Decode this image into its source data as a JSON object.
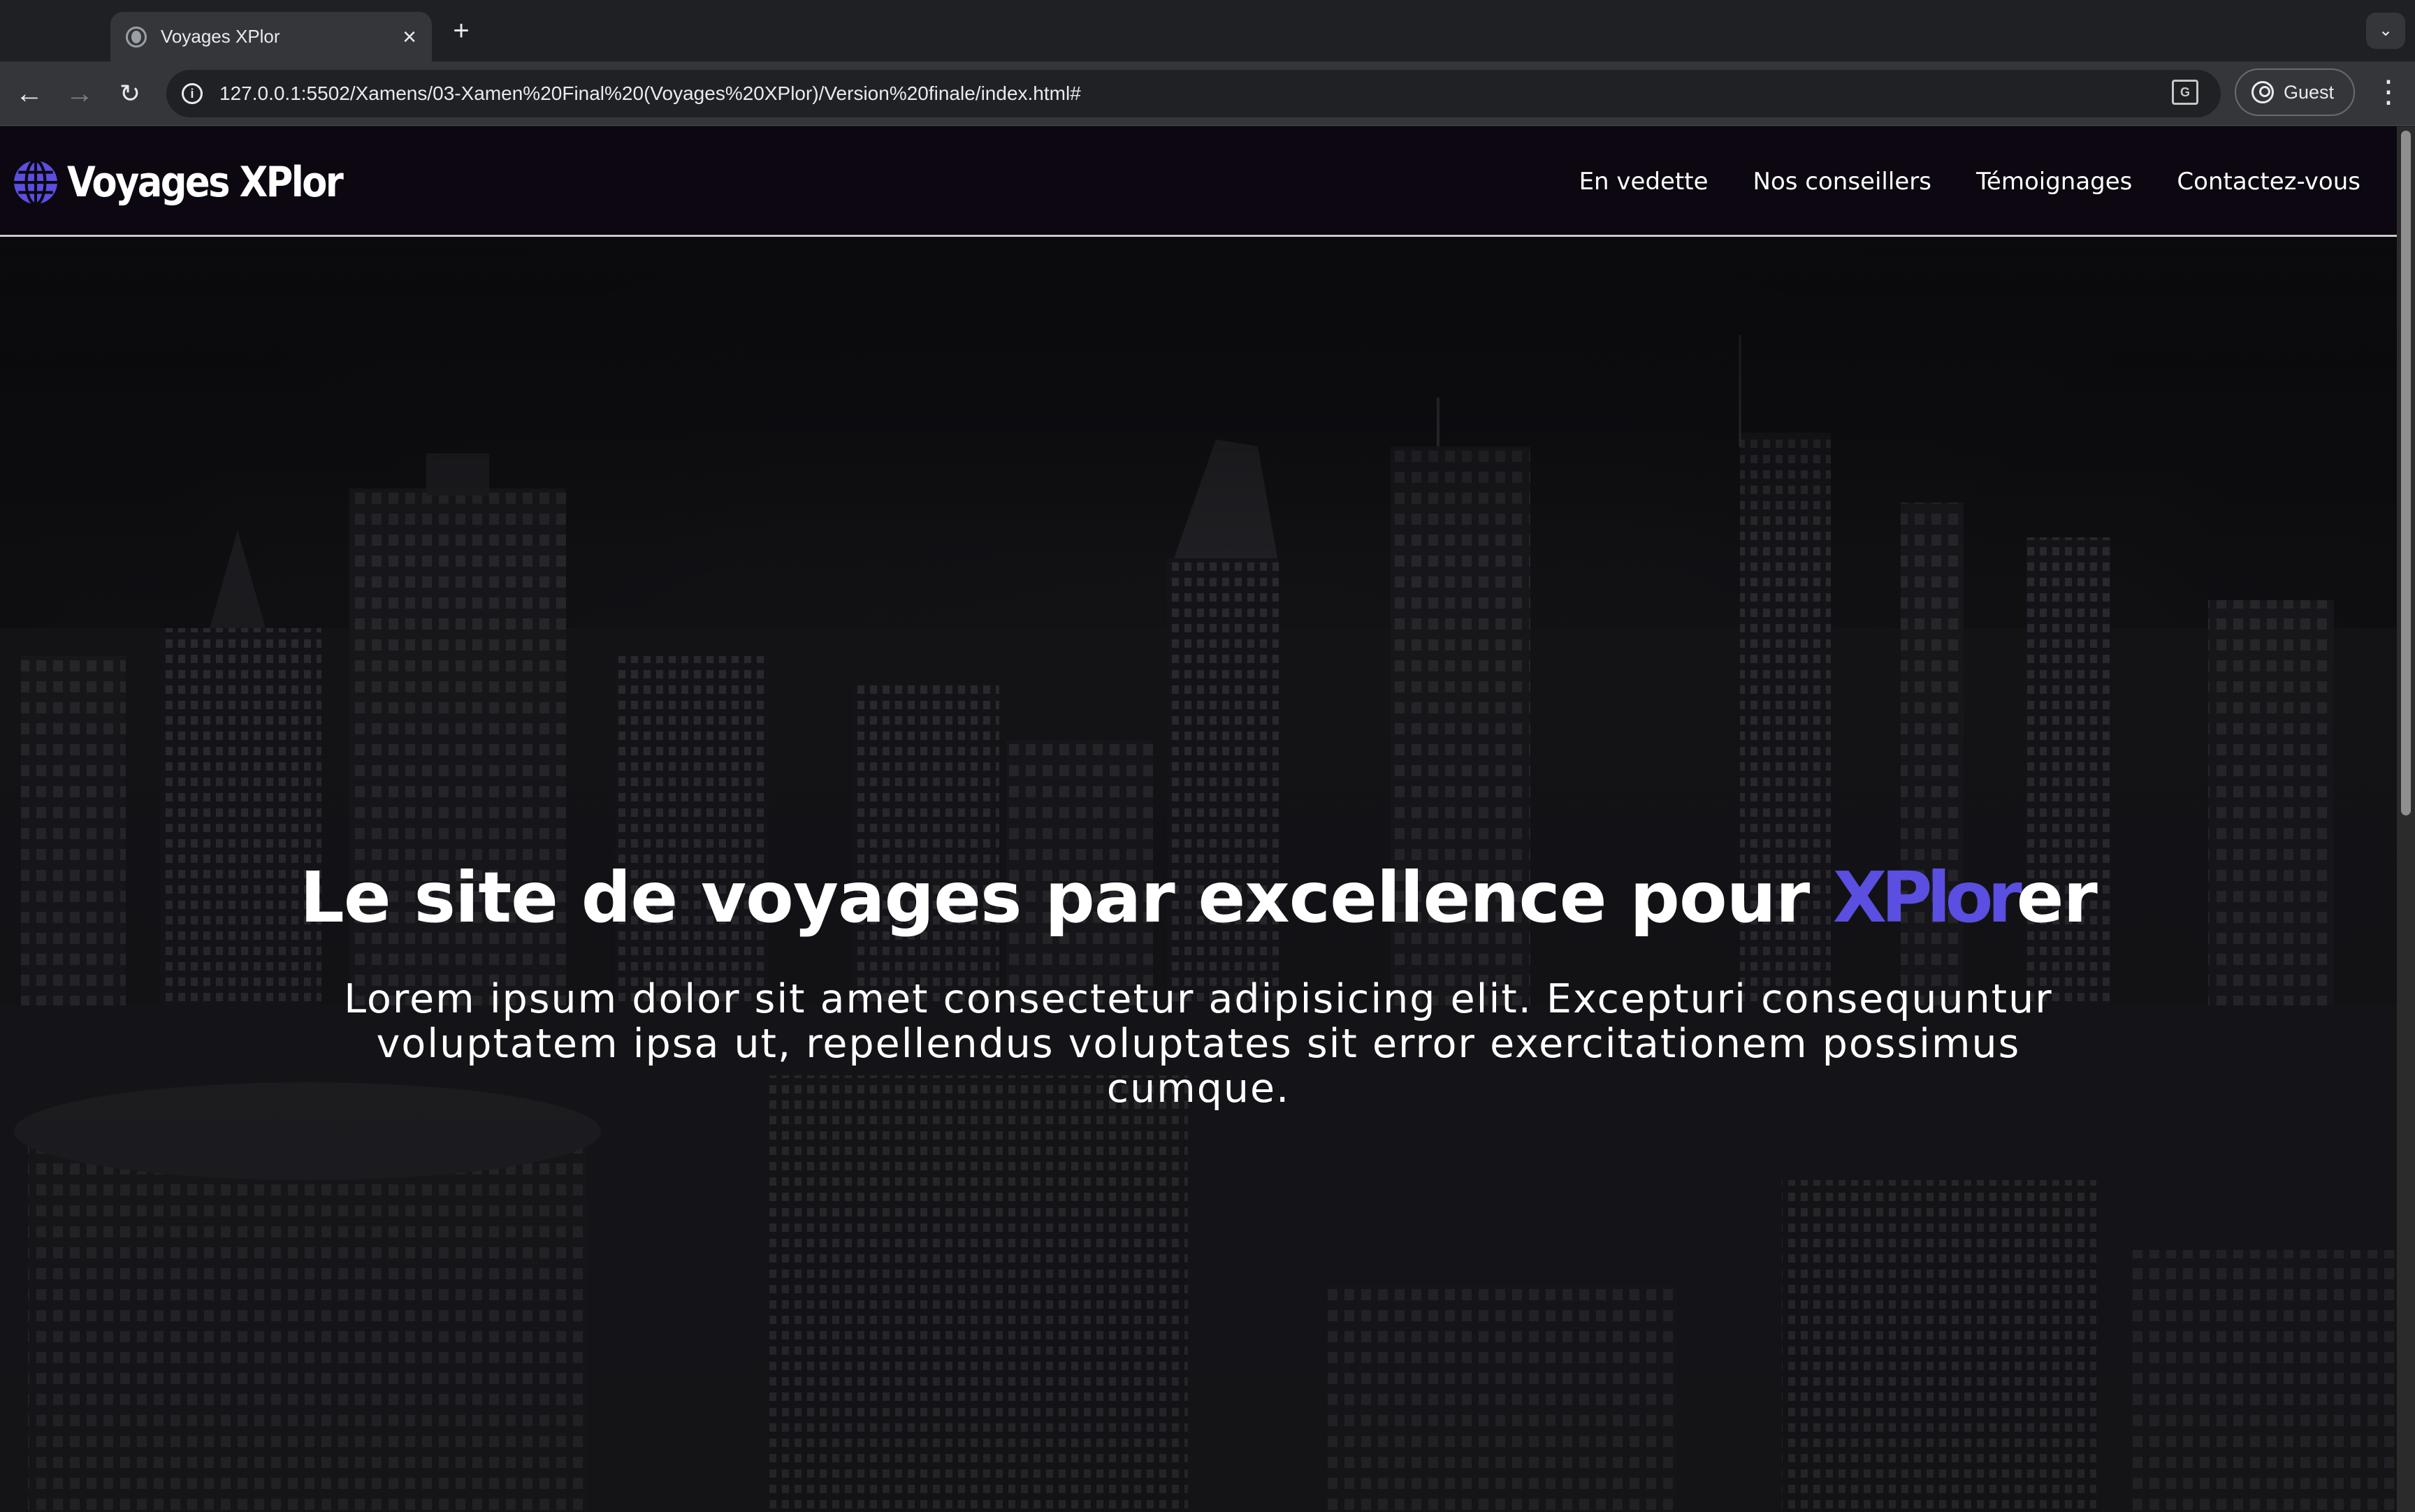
{
  "browser": {
    "tab_title": "Voyages XPlor",
    "tab_close": "×",
    "new_tab": "+",
    "tab_search": "⌄",
    "url": "127.0.0.1:5502/Xamens/03-Xamen%20Final%20(Voyages%20XPlor)/Version%20finale/index.html#",
    "profile_label": "Guest",
    "back": "←",
    "forward": "→",
    "reload": "↻",
    "menu": "⋮"
  },
  "site": {
    "logo_text": "Voyages XPlor",
    "nav": [
      {
        "label": "En vedette"
      },
      {
        "label": "Nos conseillers"
      },
      {
        "label": "Témoignages"
      },
      {
        "label": "Contactez-vous"
      }
    ]
  },
  "hero": {
    "title_before": "Le site de voyages par excellence pour ",
    "title_accent": "XPlor",
    "title_after": "er",
    "text": "Lorem ipsum dolor sit amet consectetur adipisicing elit. Excepturi consequuntur voluptatem ipsa ut, repellendus voluptates sit error exercitationem possimus cumque."
  },
  "colors": {
    "accent": "#5a4fe0",
    "header_bg": "#0c0710",
    "chrome_bg": "#35363a"
  },
  "icons": [
    "globe-icon",
    "info-icon",
    "translate-icon",
    "profile-icon"
  ]
}
